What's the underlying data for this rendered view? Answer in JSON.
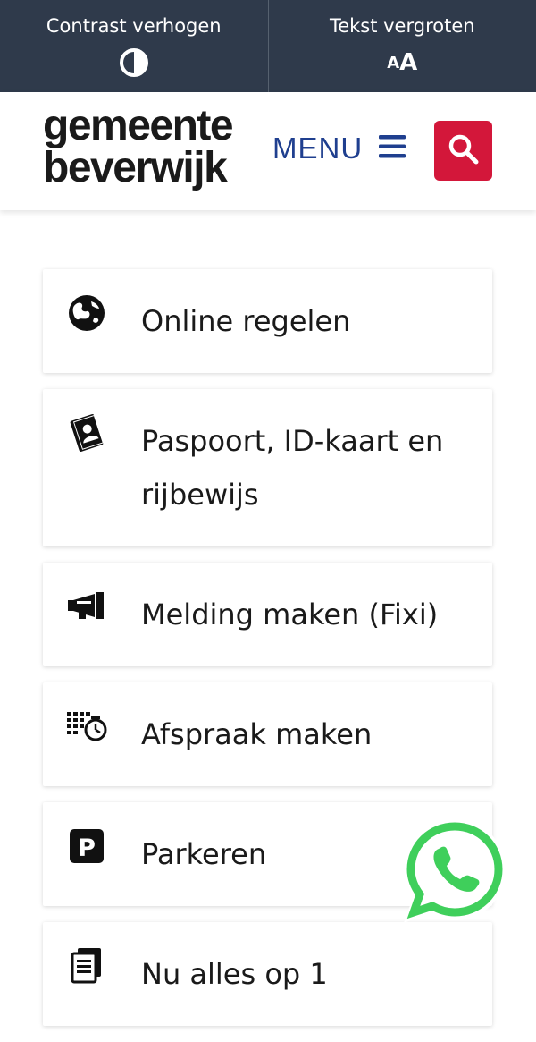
{
  "topbar": {
    "contrast_label": "Contrast verhogen",
    "contrast_icon": "contrast-icon",
    "text_size_label": "Tekst vergroten",
    "text_size_icon_small": "A",
    "text_size_icon_big": "A"
  },
  "header": {
    "logo_line1": "gemeente",
    "logo_line2": "beverwijk",
    "menu_label": "MENU",
    "menu_icon": "hamburger-icon",
    "search_icon": "search-icon"
  },
  "colors": {
    "topbar_bg": "#2f3a4b",
    "menu_blue": "#1f3f8f",
    "search_red": "#d3173a",
    "whatsapp_green": "#3fcf5b"
  },
  "cards": [
    {
      "label": "Online regelen",
      "icon": "globe-icon"
    },
    {
      "label": "Paspoort, ID-kaart en rijbewijs",
      "icon": "passport-icon"
    },
    {
      "label": "Melding maken (Fixi)",
      "icon": "megaphone-icon"
    },
    {
      "label": "Afspraak maken",
      "icon": "calendar-clock-icon"
    },
    {
      "label": "Parkeren",
      "icon": "parking-icon"
    },
    {
      "label": "Nu alles op 1",
      "icon": "documents-icon"
    }
  ],
  "floating": {
    "whatsapp_icon": "whatsapp-icon"
  }
}
